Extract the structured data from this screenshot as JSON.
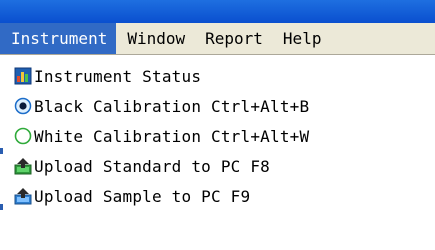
{
  "menubar": {
    "items": [
      {
        "label": "Instrument",
        "active": true
      },
      {
        "label": "Window",
        "active": false
      },
      {
        "label": "Report",
        "active": false
      },
      {
        "label": "Help",
        "active": false
      }
    ]
  },
  "dropdown": {
    "items": [
      {
        "label": "Instrument Status",
        "icon": "status-chart-icon"
      },
      {
        "label": "Black Calibration Ctrl+Alt+B",
        "icon": "radio-selected-icon"
      },
      {
        "label": "White Calibration Ctrl+Alt+W",
        "icon": "radio-unselected-icon"
      },
      {
        "label": "Upload Standard to PC F8",
        "icon": "upload-icon"
      },
      {
        "label": "Upload Sample to PC F9",
        "icon": "upload-icon"
      }
    ]
  },
  "colors": {
    "menu_highlight": "#316ac5",
    "menubar_bg": "#ece9d8",
    "titlebar": "#0a4fcf"
  }
}
